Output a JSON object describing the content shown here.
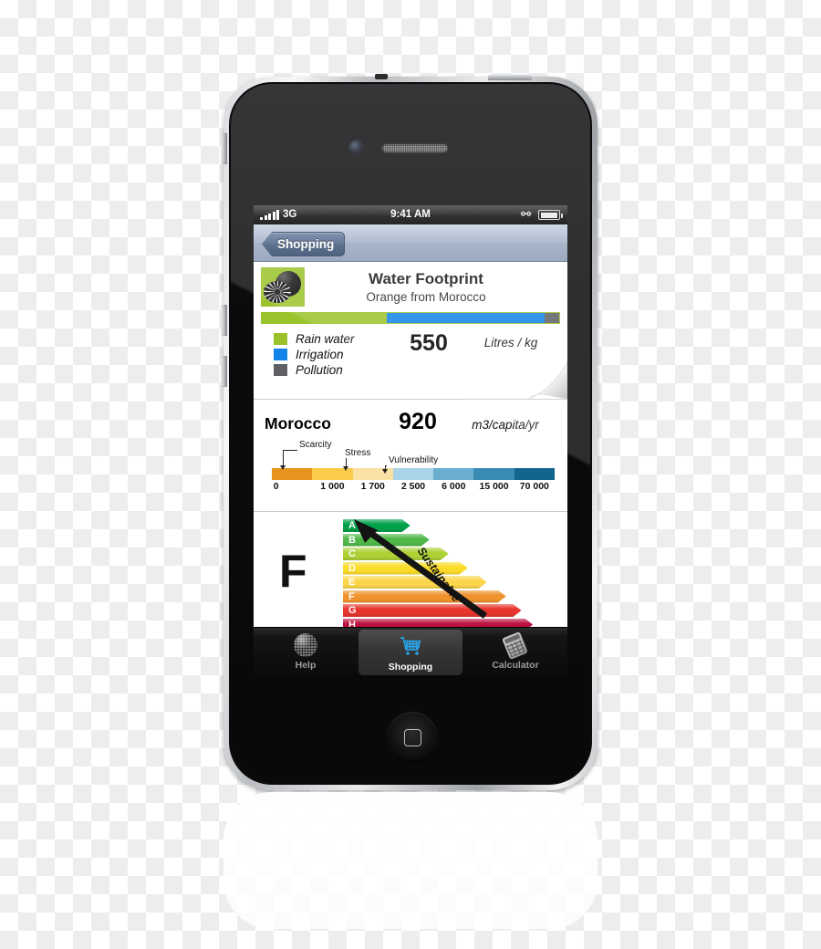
{
  "device": {
    "name": "iPhone 4",
    "camera_icon": "front-camera-icon",
    "speaker_icon": "earpiece-speaker-icon",
    "home_button_icon": "home-button-icon"
  },
  "status_bar": {
    "signal_icon": "signal-bars-icon",
    "carrier": "3G",
    "time": "9:41 AM",
    "bluetooth_icon": "bluetooth-icon",
    "battery_icon": "battery-icon"
  },
  "nav_bar": {
    "back_label": "Shopping"
  },
  "product_card": {
    "logo_icon": "orange-fruit-logo-icon",
    "title": "Water Footprint",
    "subtitle": "Orange from Morocco",
    "value": "550",
    "unit": "Litres / kg",
    "legend": [
      {
        "label": "Rain water",
        "color": "#9ac32b",
        "percent": 42
      },
      {
        "label": "Irrigation",
        "color": "#1284e8",
        "percent": 53
      },
      {
        "label": "Pollution",
        "color": "#5f6063",
        "percent": 5
      }
    ]
  },
  "country_card": {
    "country": "Morocco",
    "value": "920",
    "unit": "m3/capita/yr",
    "scale": {
      "ticks": [
        "0",
        "1 000",
        "1 700",
        "2 500",
        "6 000",
        "15 000",
        "70 000"
      ],
      "colors": [
        "#e8931e",
        "#fbcc4a",
        "#fbe2a4",
        "#a9d3e8",
        "#6aaed0",
        "#3a8cb4",
        "#13658f"
      ],
      "callouts": [
        {
          "label": "Scarcity",
          "arrow_at_percent": 4
        },
        {
          "label": "Stress",
          "arrow_at_percent": 26
        },
        {
          "label": "Vulnerability",
          "arrow_at_percent": 40
        }
      ]
    }
  },
  "rating_card": {
    "grade": "F",
    "arrow_label": "Sustainable",
    "arrow_icon": "up-right-arrow-icon",
    "bars": [
      {
        "grade": "A",
        "color": "#00a04a",
        "width_percent": 36
      },
      {
        "grade": "B",
        "color": "#4fb848",
        "width_percent": 46
      },
      {
        "grade": "C",
        "color": "#aed136",
        "width_percent": 56
      },
      {
        "grade": "D",
        "color": "#fbdb2a",
        "width_percent": 66
      },
      {
        "grade": "E",
        "color": "#fbd64a",
        "width_percent": 76
      },
      {
        "grade": "F",
        "color": "#f0932e",
        "width_percent": 86
      },
      {
        "grade": "G",
        "color": "#e8352e",
        "width_percent": 94
      },
      {
        "grade": "H",
        "color": "#bb1140",
        "width_percent": 100
      }
    ]
  },
  "tab_bar": {
    "tabs": [
      {
        "label": "Help",
        "icon": "globe-icon",
        "active": false
      },
      {
        "label": "Shopping",
        "icon": "shopping-cart-icon",
        "active": true
      },
      {
        "label": "Calculator",
        "icon": "calculator-icon",
        "active": false
      }
    ]
  }
}
